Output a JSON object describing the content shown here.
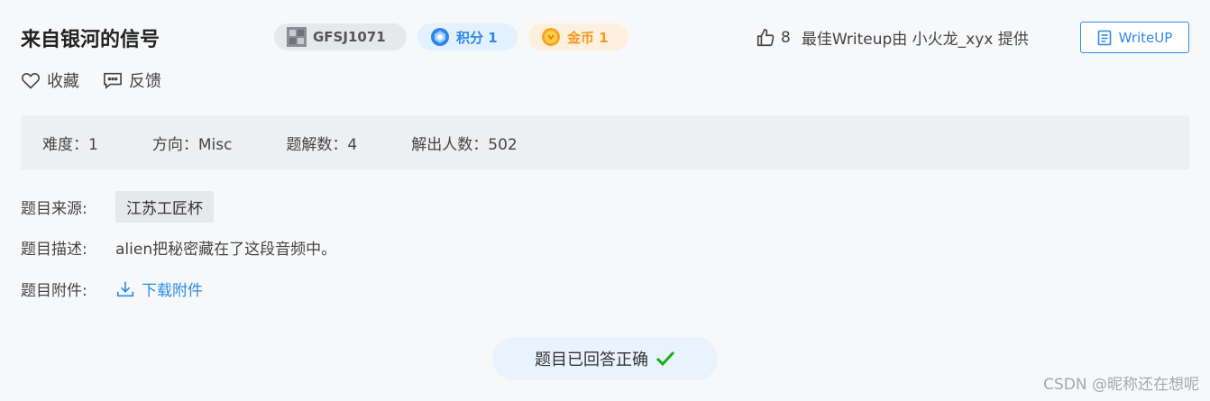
{
  "challenge": {
    "title": "来自银河的信号",
    "id": "GFSJ1071",
    "score_label": "积分 1",
    "coin_label": "金币 1"
  },
  "likes": {
    "count": "8",
    "writeup_text": "最佳Writeup由 小火龙_xyx 提供",
    "writeup_button": "WriteUP"
  },
  "actions": {
    "favorite": "收藏",
    "feedback": "反馈"
  },
  "stats": {
    "difficulty": "难度：1",
    "direction": "方向：Misc",
    "solutions": "题解数：4",
    "solvers": "解出人数：502"
  },
  "info": {
    "source_label": "题目来源:",
    "source_value": "江苏工匠杯",
    "desc_label": "题目描述:",
    "desc_value": "alien把秘密藏在了这段音频中。",
    "attach_label": "题目附件:",
    "attach_link": "下载附件"
  },
  "status": {
    "answered": "题目已回答正确"
  },
  "colors": {
    "accent": "#2f8ae6",
    "success": "#1aad19",
    "coin": "#f29b1d"
  },
  "watermark": "CSDN @昵称还在想呢"
}
